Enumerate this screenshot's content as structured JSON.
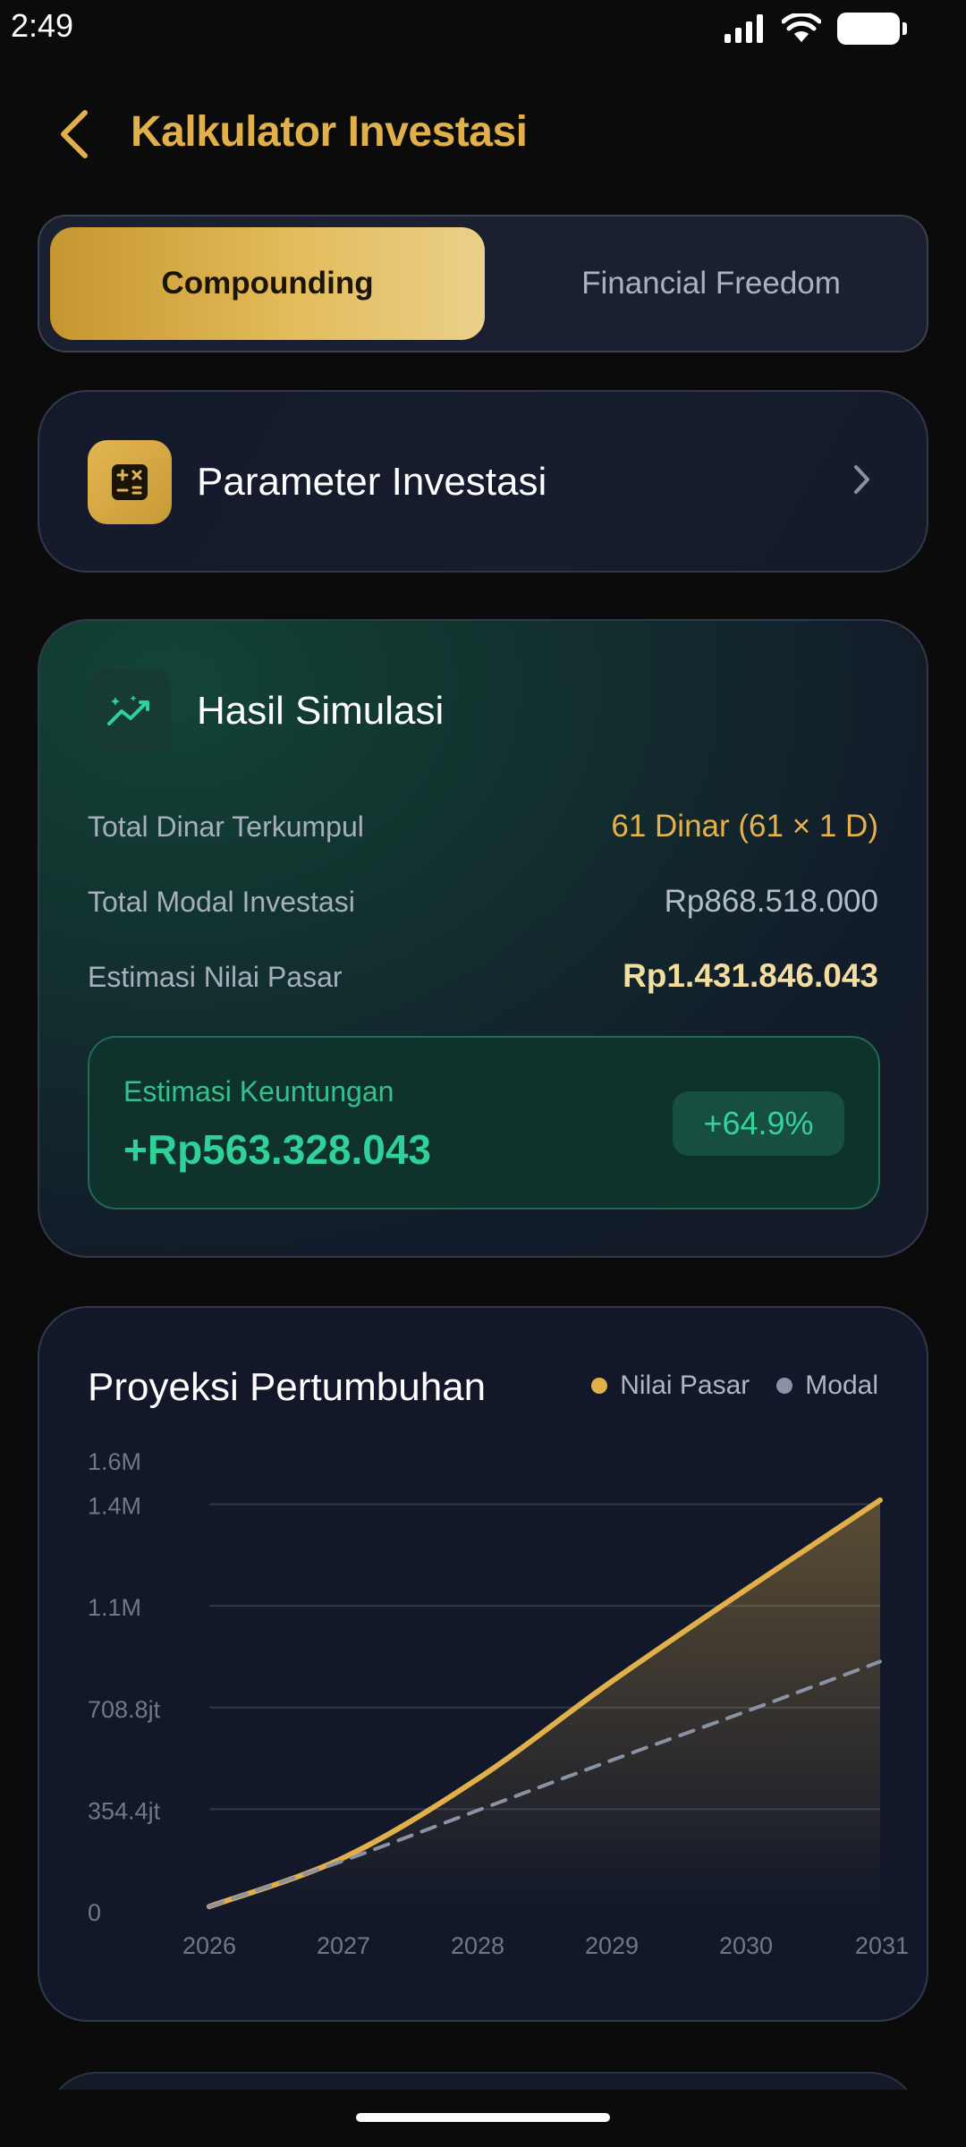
{
  "status_bar": {
    "time": "2:49"
  },
  "header": {
    "title": "Kalkulator Investasi"
  },
  "tabs": [
    {
      "label": "Compounding",
      "active": true
    },
    {
      "label": "Financial Freedom",
      "active": false
    }
  ],
  "params_card": {
    "title": "Parameter Investasi"
  },
  "result_card": {
    "title": "Hasil Simulasi",
    "rows": [
      {
        "label": "Total Dinar Terkumpul",
        "value": "61 Dinar (61 × 1 D)"
      },
      {
        "label": "Total Modal Investasi",
        "value": "Rp868.518.000"
      },
      {
        "label": "Estimasi Nilai Pasar",
        "value": "Rp1.431.846.043"
      }
    ],
    "profit": {
      "label": "Estimasi Keuntungan",
      "value": "+Rp563.328.043",
      "percent": "+64.9%"
    }
  },
  "chart_card": {
    "title": "Proyeksi Pertumbuhan",
    "legend": [
      "Nilai Pasar",
      "Modal"
    ]
  },
  "colors": {
    "accent_gold": "#e2b04a",
    "profit_green": "#2fd199",
    "modal_grey": "#8a93a6"
  },
  "chart_data": {
    "type": "line",
    "title": "Proyeksi Pertumbuhan",
    "x_tick_labels": [
      "2026",
      "2027",
      "2028",
      "2029",
      "2030",
      "2031"
    ],
    "y_tick_labels": [
      "0",
      "354.4jt",
      "708.8jt",
      "1.1M",
      "1.4M",
      "1.6M"
    ],
    "y_tick_values": [
      0,
      354.4,
      708.8,
      1063.2,
      1417.6,
      1572
    ],
    "ylim": [
      0,
      1572
    ],
    "y_unit": "jt",
    "series": [
      {
        "name": "Nilai Pasar",
        "color": "#e2b04a",
        "style": "solid",
        "x": [
          2026,
          2027,
          2028,
          2029,
          2030,
          2031
        ],
        "values": [
          15,
          185,
          460,
          800,
          1120,
          1432
        ]
      },
      {
        "name": "Modal",
        "color": "#8a93a6",
        "style": "dashed",
        "x": [
          2026,
          2027,
          2028,
          2029,
          2030,
          2031
        ],
        "values": [
          15,
          175,
          350,
          525,
          695,
          869
        ]
      }
    ],
    "grid": true,
    "legend_position": "top-right"
  }
}
